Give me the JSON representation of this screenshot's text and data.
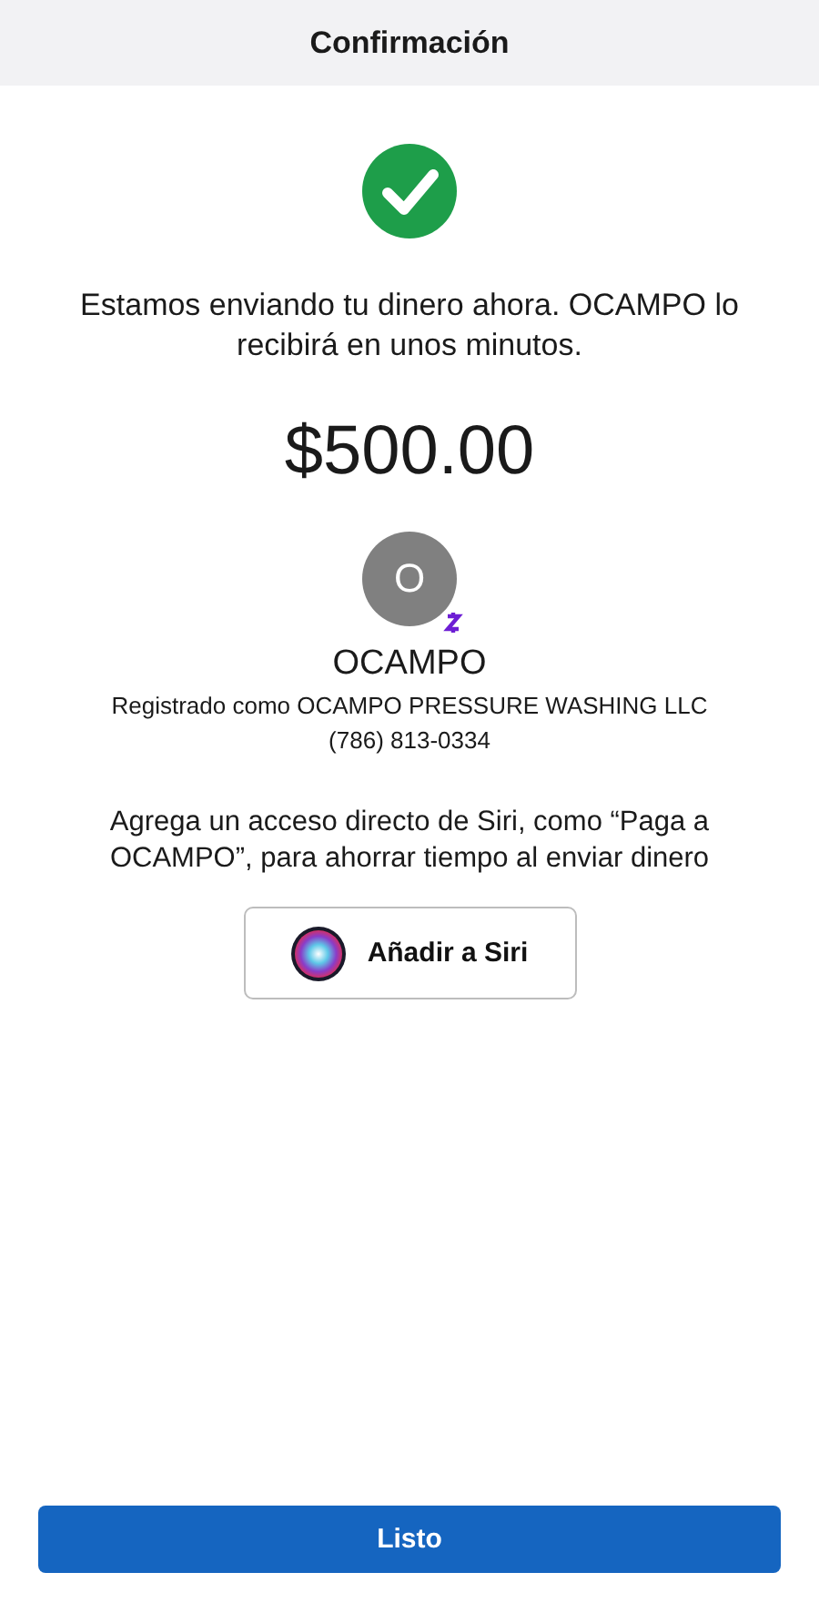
{
  "header": {
    "title": "Confirmación"
  },
  "message": "Estamos enviando tu dinero ahora. OCAMPO lo recibirá en unos minutos.",
  "amount": "$500.00",
  "recipient": {
    "initial": "O",
    "name": "OCAMPO",
    "registered": "Registrado como OCAMPO PRESSURE WASHING LLC",
    "phone": "(786) 813-0334"
  },
  "siri": {
    "text": "Agrega un acceso directo de Siri, como “Paga a OCAMPO”, para ahorrar tiempo al enviar dinero",
    "button": "Añadir a Siri"
  },
  "done_button": "Listo"
}
